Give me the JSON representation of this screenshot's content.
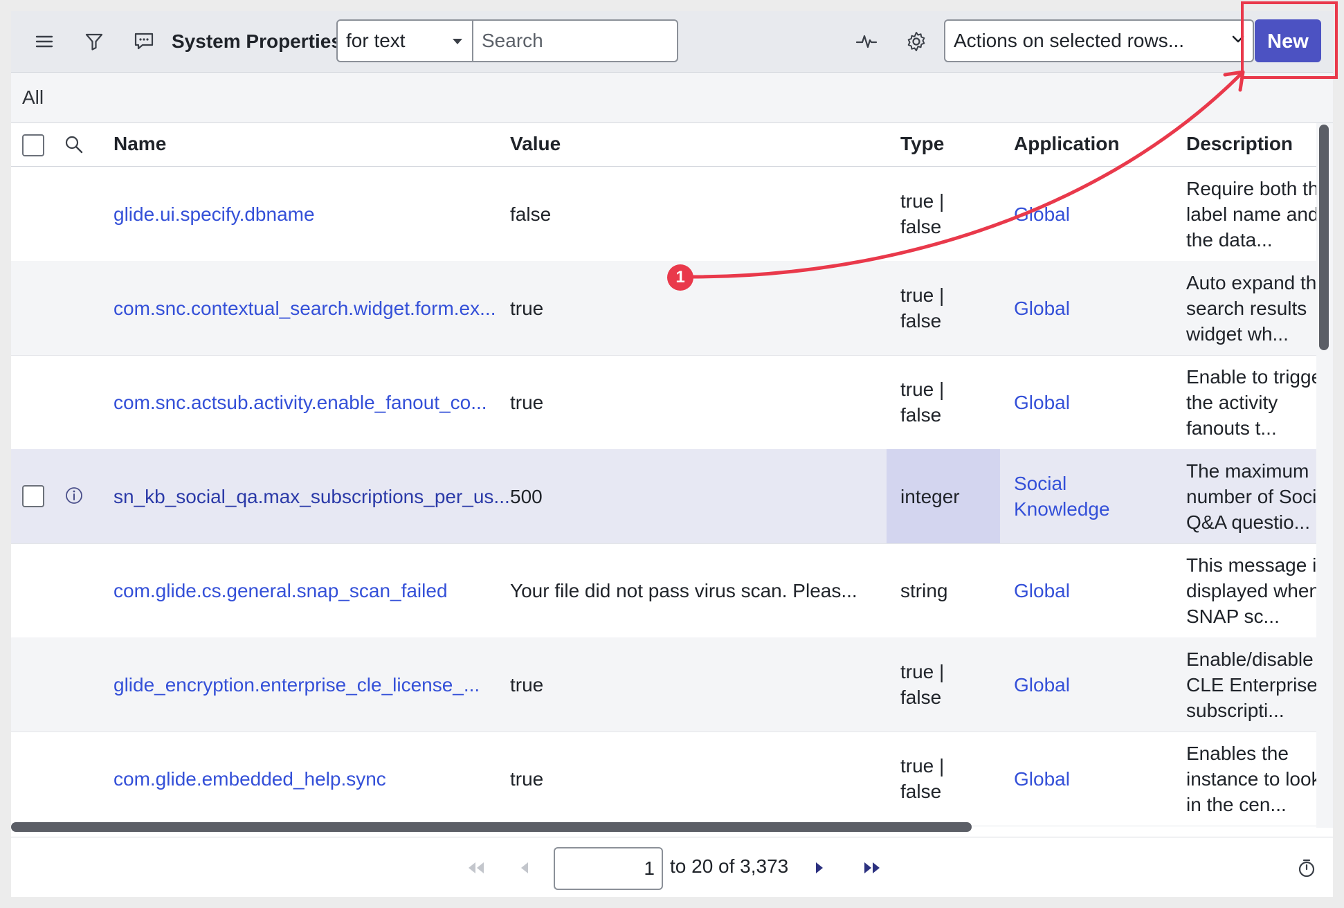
{
  "toolbar": {
    "title": "System Properties",
    "field_select": "for text",
    "search_placeholder": "Search",
    "actions_select": "Actions on selected rows...",
    "new_label": "New"
  },
  "breadcrumb": {
    "label": "All"
  },
  "table": {
    "headers": {
      "name": "Name",
      "value": "Value",
      "type": "Type",
      "application": "Application",
      "description": "Description"
    },
    "rows": [
      {
        "name": "glide.ui.specify.dbname",
        "value": "false",
        "type": [
          "true |",
          "false"
        ],
        "application": [
          "Global"
        ],
        "description": [
          "Require both th",
          "label name and",
          "the data..."
        ]
      },
      {
        "name": "com.snc.contextual_search.widget.form.ex...",
        "value": "true",
        "type": [
          "true |",
          "false"
        ],
        "application": [
          "Global"
        ],
        "description": [
          "Auto expand th",
          "search results",
          "widget wh..."
        ]
      },
      {
        "name": "com.snc.actsub.activity.enable_fanout_co...",
        "value": "true",
        "type": [
          "true |",
          "false"
        ],
        "application": [
          "Global"
        ],
        "description": [
          "Enable to trigge",
          "the activity",
          "fanouts t..."
        ]
      },
      {
        "name": "sn_kb_social_qa.max_subscriptions_per_us...",
        "value": "500",
        "type": [
          "integer"
        ],
        "application": [
          "Social",
          "Knowledge"
        ],
        "description": [
          "The maximum",
          "number of Socia",
          "Q&A questio..."
        ]
      },
      {
        "name": "com.glide.cs.general.snap_scan_failed",
        "value": "Your file did not pass virus scan. Pleas...",
        "type": [
          "string"
        ],
        "application": [
          "Global"
        ],
        "description": [
          "This message is",
          "displayed when",
          "SNAP sc..."
        ]
      },
      {
        "name": "glide_encryption.enterprise_cle_license_...",
        "value": "true",
        "type": [
          "true |",
          "false"
        ],
        "application": [
          "Global"
        ],
        "description": [
          "Enable/disable",
          "CLE Enterprise",
          "subscripti..."
        ]
      },
      {
        "name": "com.glide.embedded_help.sync",
        "value": "true",
        "type": [
          "true |",
          "false"
        ],
        "application": [
          "Global"
        ],
        "description": [
          "Enables the",
          "instance to look",
          "in the cen..."
        ]
      }
    ]
  },
  "pagination": {
    "current": "1",
    "range": "to 20 of 3,373"
  },
  "annotation": {
    "badge": "1"
  },
  "colors": {
    "accent": "#4c52c2",
    "link": "#3450d8",
    "annotation": "#e9394b"
  }
}
